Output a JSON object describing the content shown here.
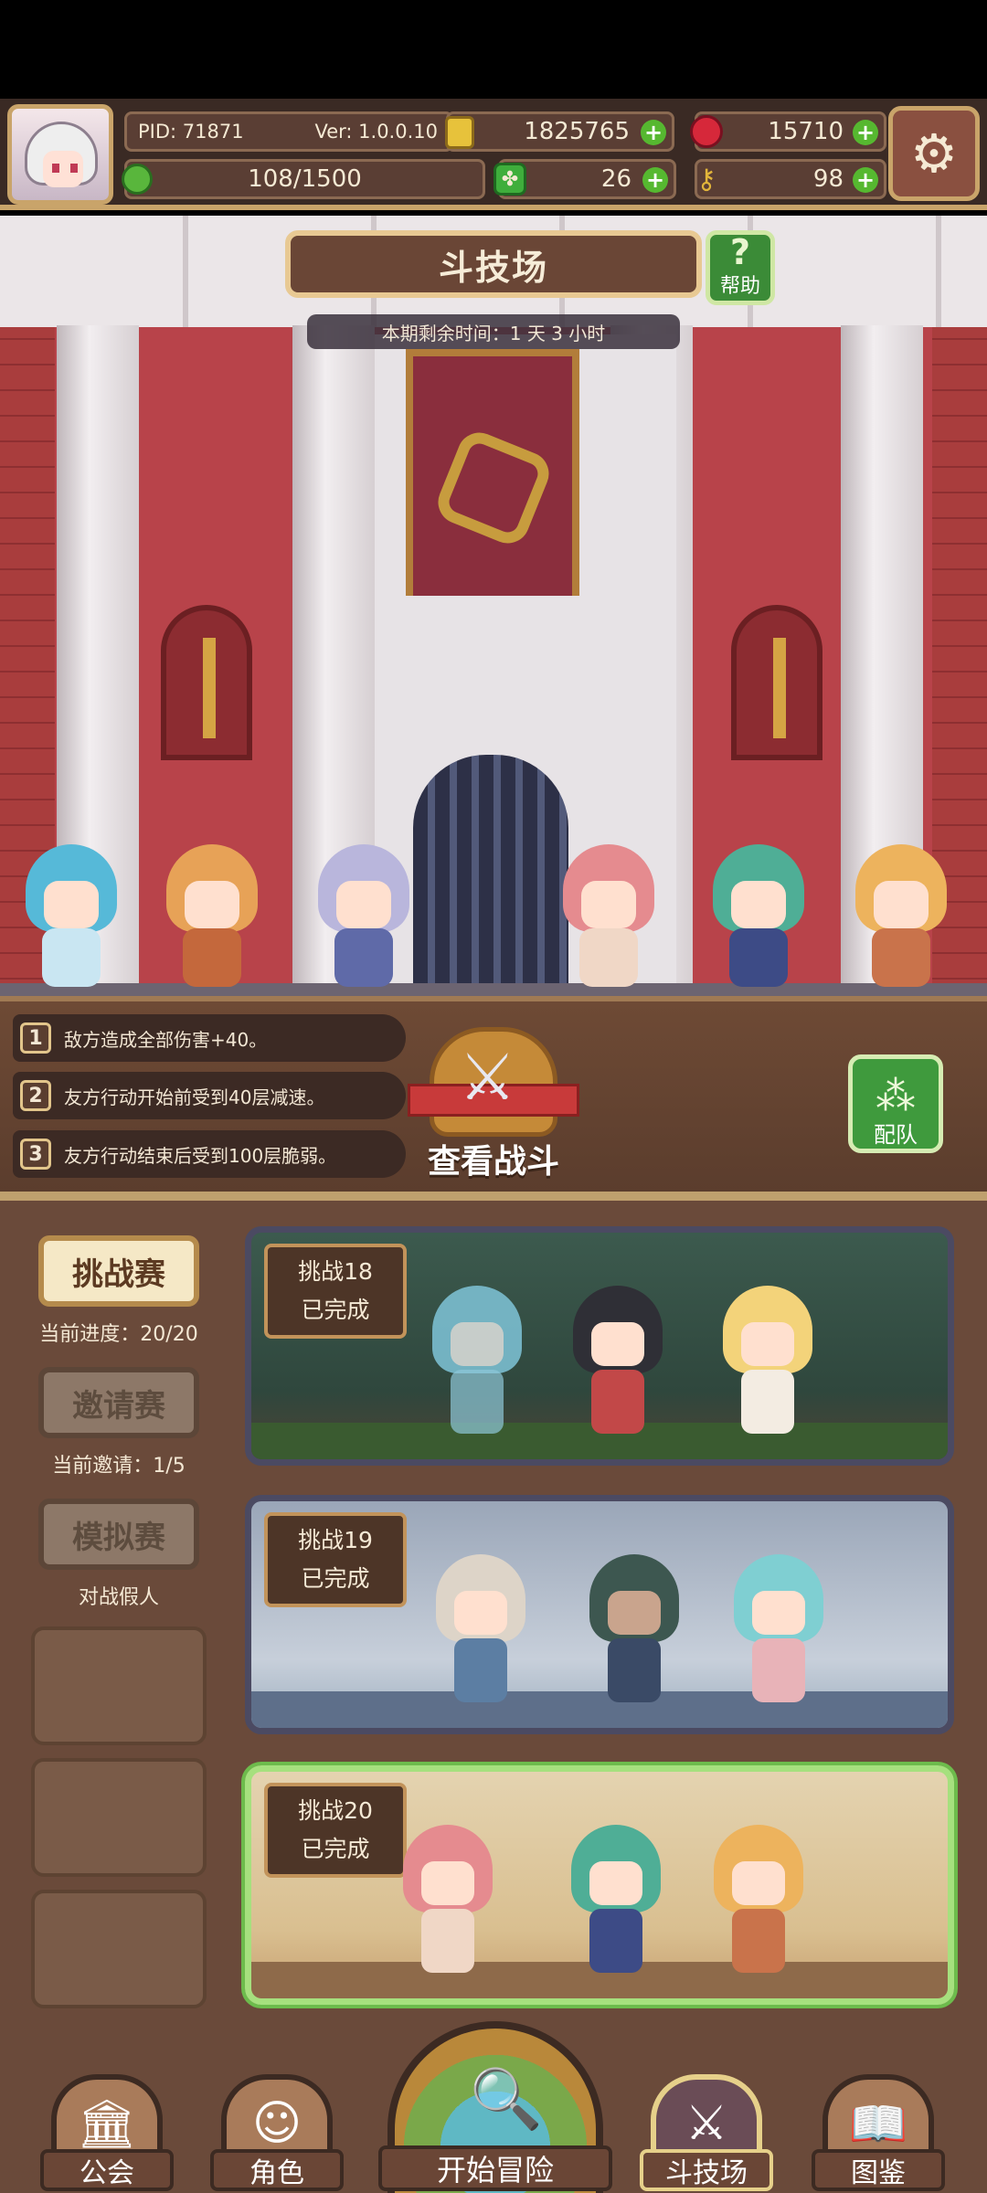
{
  "hud": {
    "pid": "PID: 71871",
    "version": "Ver: 1.0.0.10",
    "gold": "1825765",
    "gems": "15710",
    "energy": "108/1500",
    "clovers": "26",
    "keys": "98"
  },
  "arena": {
    "title": "斗技场",
    "help_label": "帮助",
    "timer": "本期剩余时间：1 天 3 小时"
  },
  "rules": [
    {
      "num": "1",
      "text": "敌方造成全部伤害+40。"
    },
    {
      "num": "2",
      "text": "友方行动开始前受到40层减速。"
    },
    {
      "num": "3",
      "text": "友方行动结束后受到100层脆弱。"
    }
  ],
  "actions": {
    "view_battle": "查看战斗",
    "team": "配队"
  },
  "modes": [
    {
      "label": "挑战赛",
      "sub": "当前进度：20/20",
      "active": true
    },
    {
      "label": "邀请赛",
      "sub": "当前邀请：1/5",
      "active": false
    },
    {
      "label": "模拟赛",
      "sub": "对战假人",
      "active": false
    }
  ],
  "challenges": [
    {
      "name": "挑战18",
      "status": "已完成"
    },
    {
      "name": "挑战19",
      "status": "已完成"
    },
    {
      "name": "挑战20",
      "status": "已完成"
    }
  ],
  "nav": {
    "guild": "公会",
    "characters": "角色",
    "adventure": "开始冒险",
    "arena": "斗技场",
    "codex": "图鉴"
  },
  "colors": {
    "accent_green": "#56b830",
    "frame_gold": "#c9a46a",
    "panel_brown": "#6a4a3a",
    "selected_border": "#a6e07e"
  }
}
